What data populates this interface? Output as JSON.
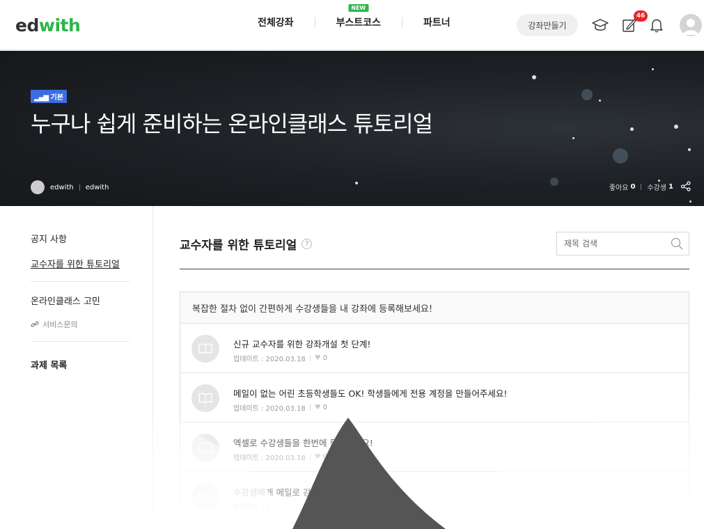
{
  "header": {
    "logo_ed": "ed",
    "logo_with": "with",
    "nav": [
      {
        "label": "전체강좌"
      },
      {
        "label": "부스트코스",
        "badge": "NEW"
      },
      {
        "label": "파트너"
      }
    ],
    "make_course_label": "강좌만들기",
    "notification_count": "46",
    "icons": [
      "graduation-cap-icon",
      "edit-icon",
      "bell-icon",
      "avatar"
    ]
  },
  "hero": {
    "level_badge": "기본",
    "title": "누구나 쉽게 준비하는 온라인클래스 튜토리얼",
    "author": "edwith",
    "org": "edwith",
    "likes_label": "좋아요",
    "likes": "0",
    "students_label": "수강생",
    "students": "1"
  },
  "sidebar": {
    "notice": "공지 사항",
    "tutorial": "교수자를 위한 튜토리얼",
    "worries": "온라인클래스 고민",
    "service": "서비스문의",
    "assignments": "과제 목록"
  },
  "main": {
    "section_title": "교수자를 위한 튜토리얼",
    "help": "?",
    "search_placeholder": "제목 검색",
    "board_header": "복잡한 절차 없이 간편하게 수강생들을 내 강좌에 등록해보세요!",
    "rows": [
      {
        "title": "신규 교수자를 위한 강좌개설 첫 단계!",
        "updated": "업데이트 : 2020.03.18",
        "likes": "0"
      },
      {
        "title": "메일이 없는 어린 초등학생들도 OK! 학생들에게 전용 계정을 만들어주세요!",
        "updated": "업데이트 : 2020.03.18",
        "likes": "0"
      },
      {
        "title": "엑셀로 수강생들을 한번에 등록하세요!",
        "updated": "업데이트 : 2020.03.18",
        "likes": "0"
      },
      {
        "title": "수강생에게 메일로 강좌에 초대하기",
        "updated": "업데이트 : 2",
        "likes": ""
      }
    ]
  },
  "colors": {
    "brand_green": "#2bb64b",
    "notif_red": "#e8232a",
    "level_blue": "#3d6ce0"
  }
}
